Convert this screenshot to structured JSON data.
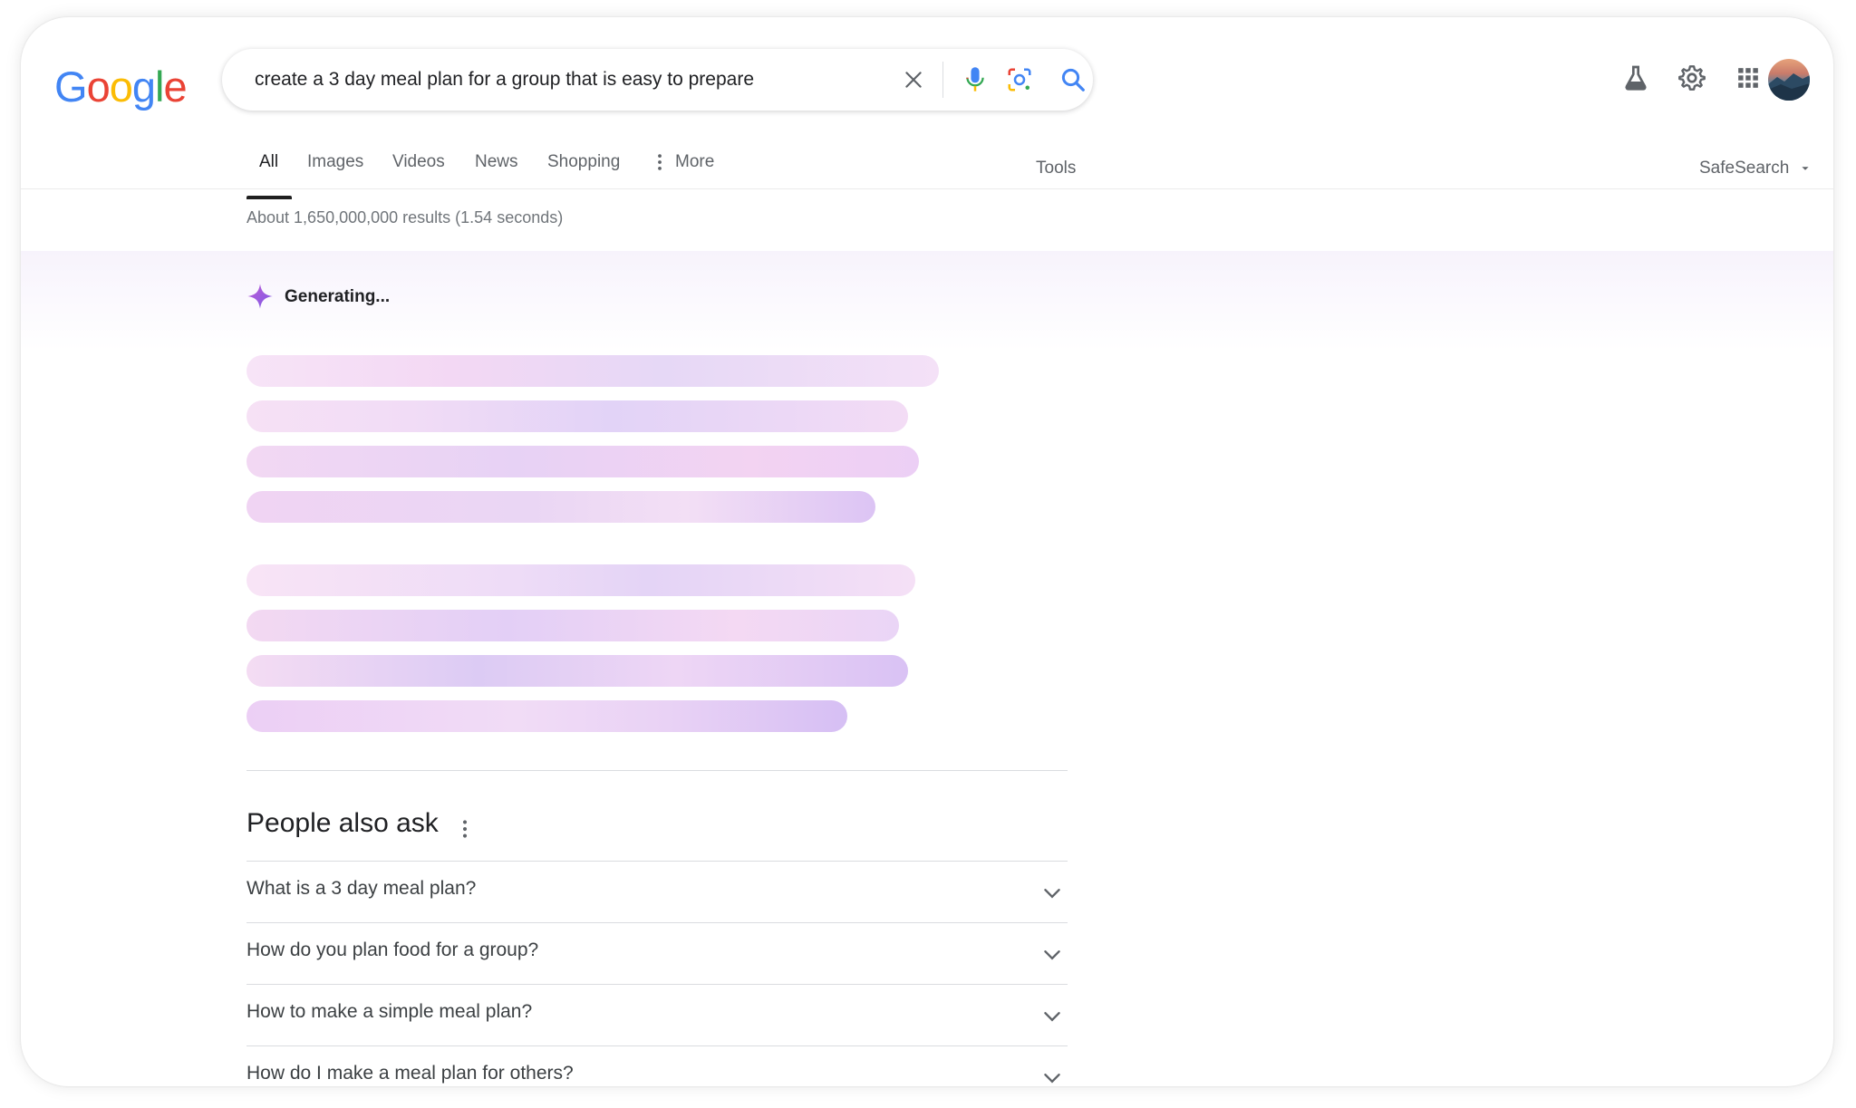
{
  "logo": {
    "text": "Google"
  },
  "search": {
    "query": "create a 3 day meal plan for a group that is easy to prepare"
  },
  "tabs": [
    {
      "label": "All",
      "active": true
    },
    {
      "label": "Images"
    },
    {
      "label": "Videos"
    },
    {
      "label": "News"
    },
    {
      "label": "Shopping"
    },
    {
      "label": "More"
    }
  ],
  "tools_label": "Tools",
  "safesearch_label": "SafeSearch",
  "results_count": "About 1,650,000,000 results (1.54 seconds)",
  "ai": {
    "status": "Generating..."
  },
  "people_also_ask": {
    "title": "People also ask",
    "questions": [
      "What is a 3 day meal plan?",
      "How do you plan food for a group?",
      "How to make a simple meal plan?",
      "How do I make a meal plan for others?"
    ]
  },
  "colors": {
    "google_blue": "#4285F4",
    "google_red": "#EA4335",
    "google_yellow": "#FBBC05",
    "google_green": "#34A853",
    "accent_purple": "#a66bdc"
  },
  "icons": {
    "clear": "close-icon",
    "voice": "microphone-icon",
    "lens": "lens-icon",
    "search": "search-icon",
    "labs": "flask-icon",
    "settings": "gear-icon",
    "apps": "apps-grid-icon"
  }
}
